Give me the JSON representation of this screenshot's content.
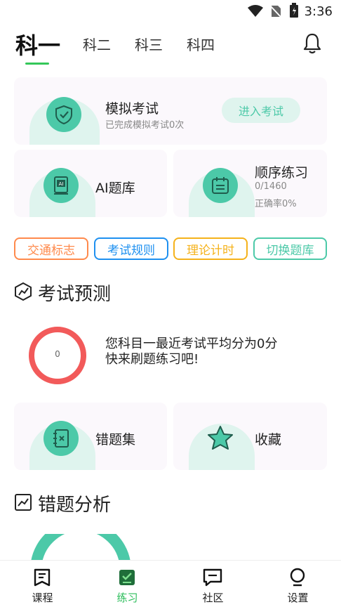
{
  "status_bar": {
    "time": "3:36"
  },
  "top_tabs": [
    "科一",
    "科二",
    "科三",
    "科四"
  ],
  "mock_exam": {
    "title": "模拟考试",
    "subtitle": "已完成模拟考试0次",
    "button": "进入考试"
  },
  "ai_bank": {
    "title": "AI题库"
  },
  "sequential": {
    "title": "顺序练习",
    "progress": "0/1460",
    "accuracy": "正确率0%"
  },
  "chips": [
    "交通标志",
    "考试规则",
    "理论计时",
    "切换题库"
  ],
  "prediction": {
    "title": "考试预测",
    "score": "0",
    "line1": "您科目一最近考试平均分为0分",
    "line2": "快来刷题练习吧!"
  },
  "wrong_set": {
    "title": "错题集"
  },
  "favorites": {
    "title": "收藏"
  },
  "analysis": {
    "title": "错题分析"
  },
  "bottom_nav": [
    "课程",
    "练习",
    "社区",
    "设置"
  ],
  "colors": {
    "accent": "#4cc9a8",
    "active_green": "#2bbd5a",
    "chip1": "#ff8a4c",
    "chip2": "#1e90f0",
    "chip3": "#f5b21b",
    "chip4": "#4cc9a8",
    "ring": "#f25a5a"
  }
}
